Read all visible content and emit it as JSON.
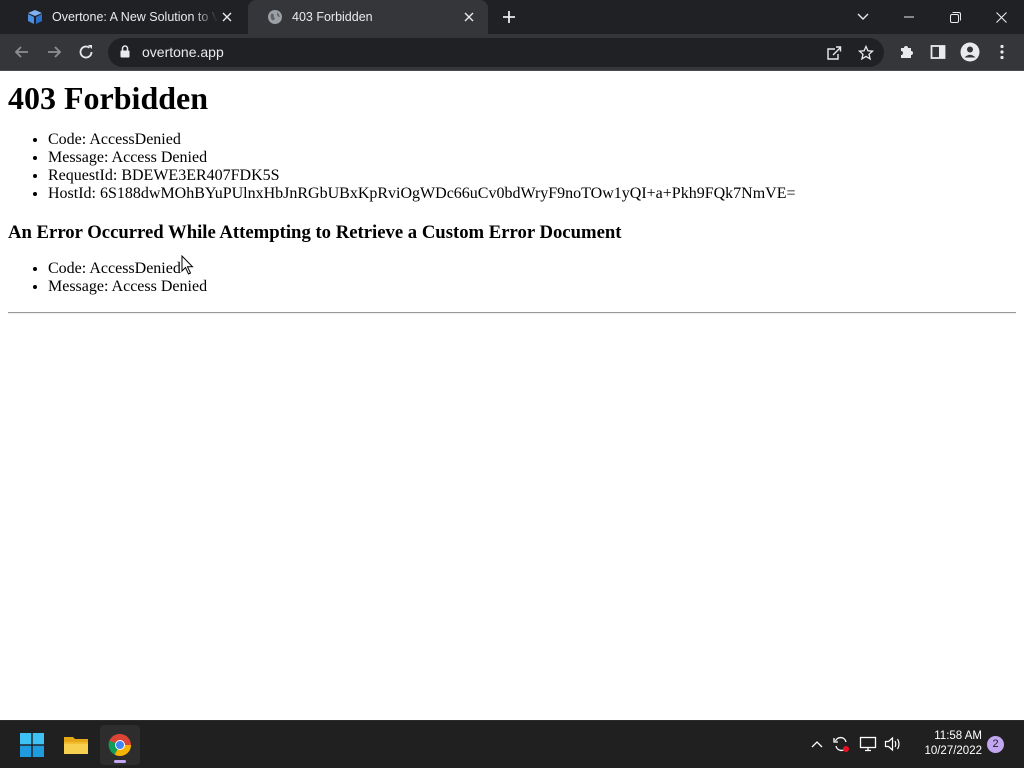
{
  "browser": {
    "tabs": [
      {
        "title": "Overtone: A New Solution to Voice",
        "active": false
      },
      {
        "title": "403 Forbidden",
        "active": true
      }
    ],
    "url": "overtone.app"
  },
  "page": {
    "heading": "403 Forbidden",
    "error_items": [
      "Code: AccessDenied",
      "Message: Access Denied",
      "RequestId: BDEWE3ER407FDK5S",
      "HostId: 6S188dwMOhBYuPUlnxHbJnRGbUBxKpRviOgWDc66uCv0bdWryF9noTOw1yQI+a+Pkh9FQk7NmVE="
    ],
    "subheading": "An Error Occurred While Attempting to Retrieve a Custom Error Document",
    "custom_error_items": [
      "Code: AccessDenied",
      "Message: Access Denied"
    ]
  },
  "taskbar": {
    "apps": [
      "start-icon",
      "file-explorer-icon",
      "chrome-icon"
    ],
    "time": "11:58 AM",
    "date": "10/27/2022",
    "notification_count": "2"
  },
  "colors": {
    "tabstrip_bg": "#202124",
    "toolbar_bg": "#35363a",
    "omnibox_bg": "#202124",
    "taskbar_bg": "#202020",
    "accent": "#c3a6f2"
  }
}
